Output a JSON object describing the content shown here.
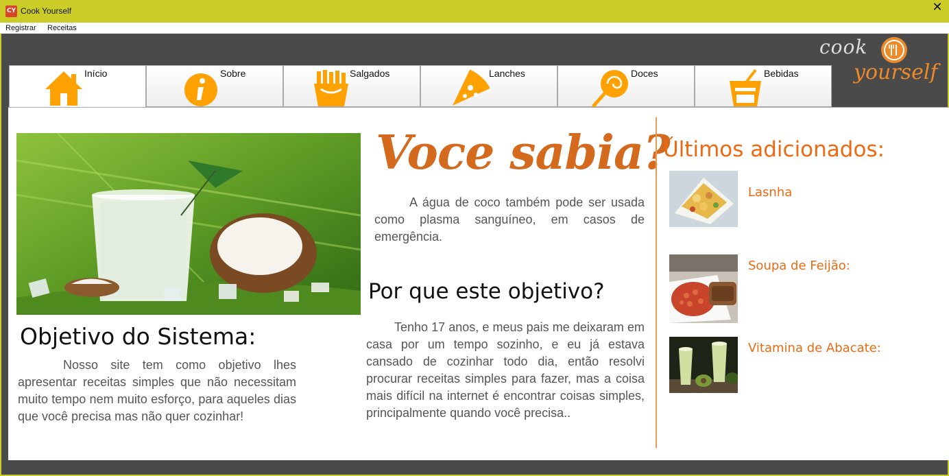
{
  "window": {
    "title": "Cook Yourself",
    "icon_text": "CY",
    "close_symbol": "✕"
  },
  "menu": [
    {
      "label": "Registrar"
    },
    {
      "label": "Receitas"
    }
  ],
  "logo": {
    "line1": "cook",
    "line2": "yourself"
  },
  "tabs": [
    {
      "label": "Início",
      "icon": "house-icon"
    },
    {
      "label": "Sobre",
      "icon": "info-icon"
    },
    {
      "label": "Salgados",
      "icon": "fries-icon"
    },
    {
      "label": "Lanches",
      "icon": "pizza-icon"
    },
    {
      "label": "Doces",
      "icon": "lollipop-icon"
    },
    {
      "label": "Bebidas",
      "icon": "drink-icon"
    }
  ],
  "main": {
    "objective_title": "Objetivo do Sistema:",
    "objective_text": "Nosso site tem como objetivo lhes apresentar receitas simples que não necessitam muito tempo nem muito esforço, para aqueles dias que você precisa mas não quer cozinhar!",
    "fact_title": "Voce sabia?",
    "fact_text": "A água de coco também pode ser usada como plasma sanguíneo, em casos de emergência.",
    "why_title": "Por que este objetivo?",
    "why_text": "Tenho 17 anos, e meus pais me deixaram em casa por um tempo sozinho, e eu já estava cansado de cozinhar todo dia, então resolvi procurar receitas simples para fazer, mas a coisa mais difícil na internet é encontrar coisas simples, principalmente quando você precisa.."
  },
  "sidebar": {
    "title": "Últimos adicionados:",
    "recipes": [
      {
        "name": "Lasnha"
      },
      {
        "name": "Soupa de Feijão:"
      },
      {
        "name": "Vitamina de Abacate:"
      }
    ]
  },
  "colors": {
    "accent": "#ee8a2a",
    "title_bar": "#cccc28",
    "dark_bg": "#4a4a4a",
    "orange_text": "#ee6a12"
  }
}
